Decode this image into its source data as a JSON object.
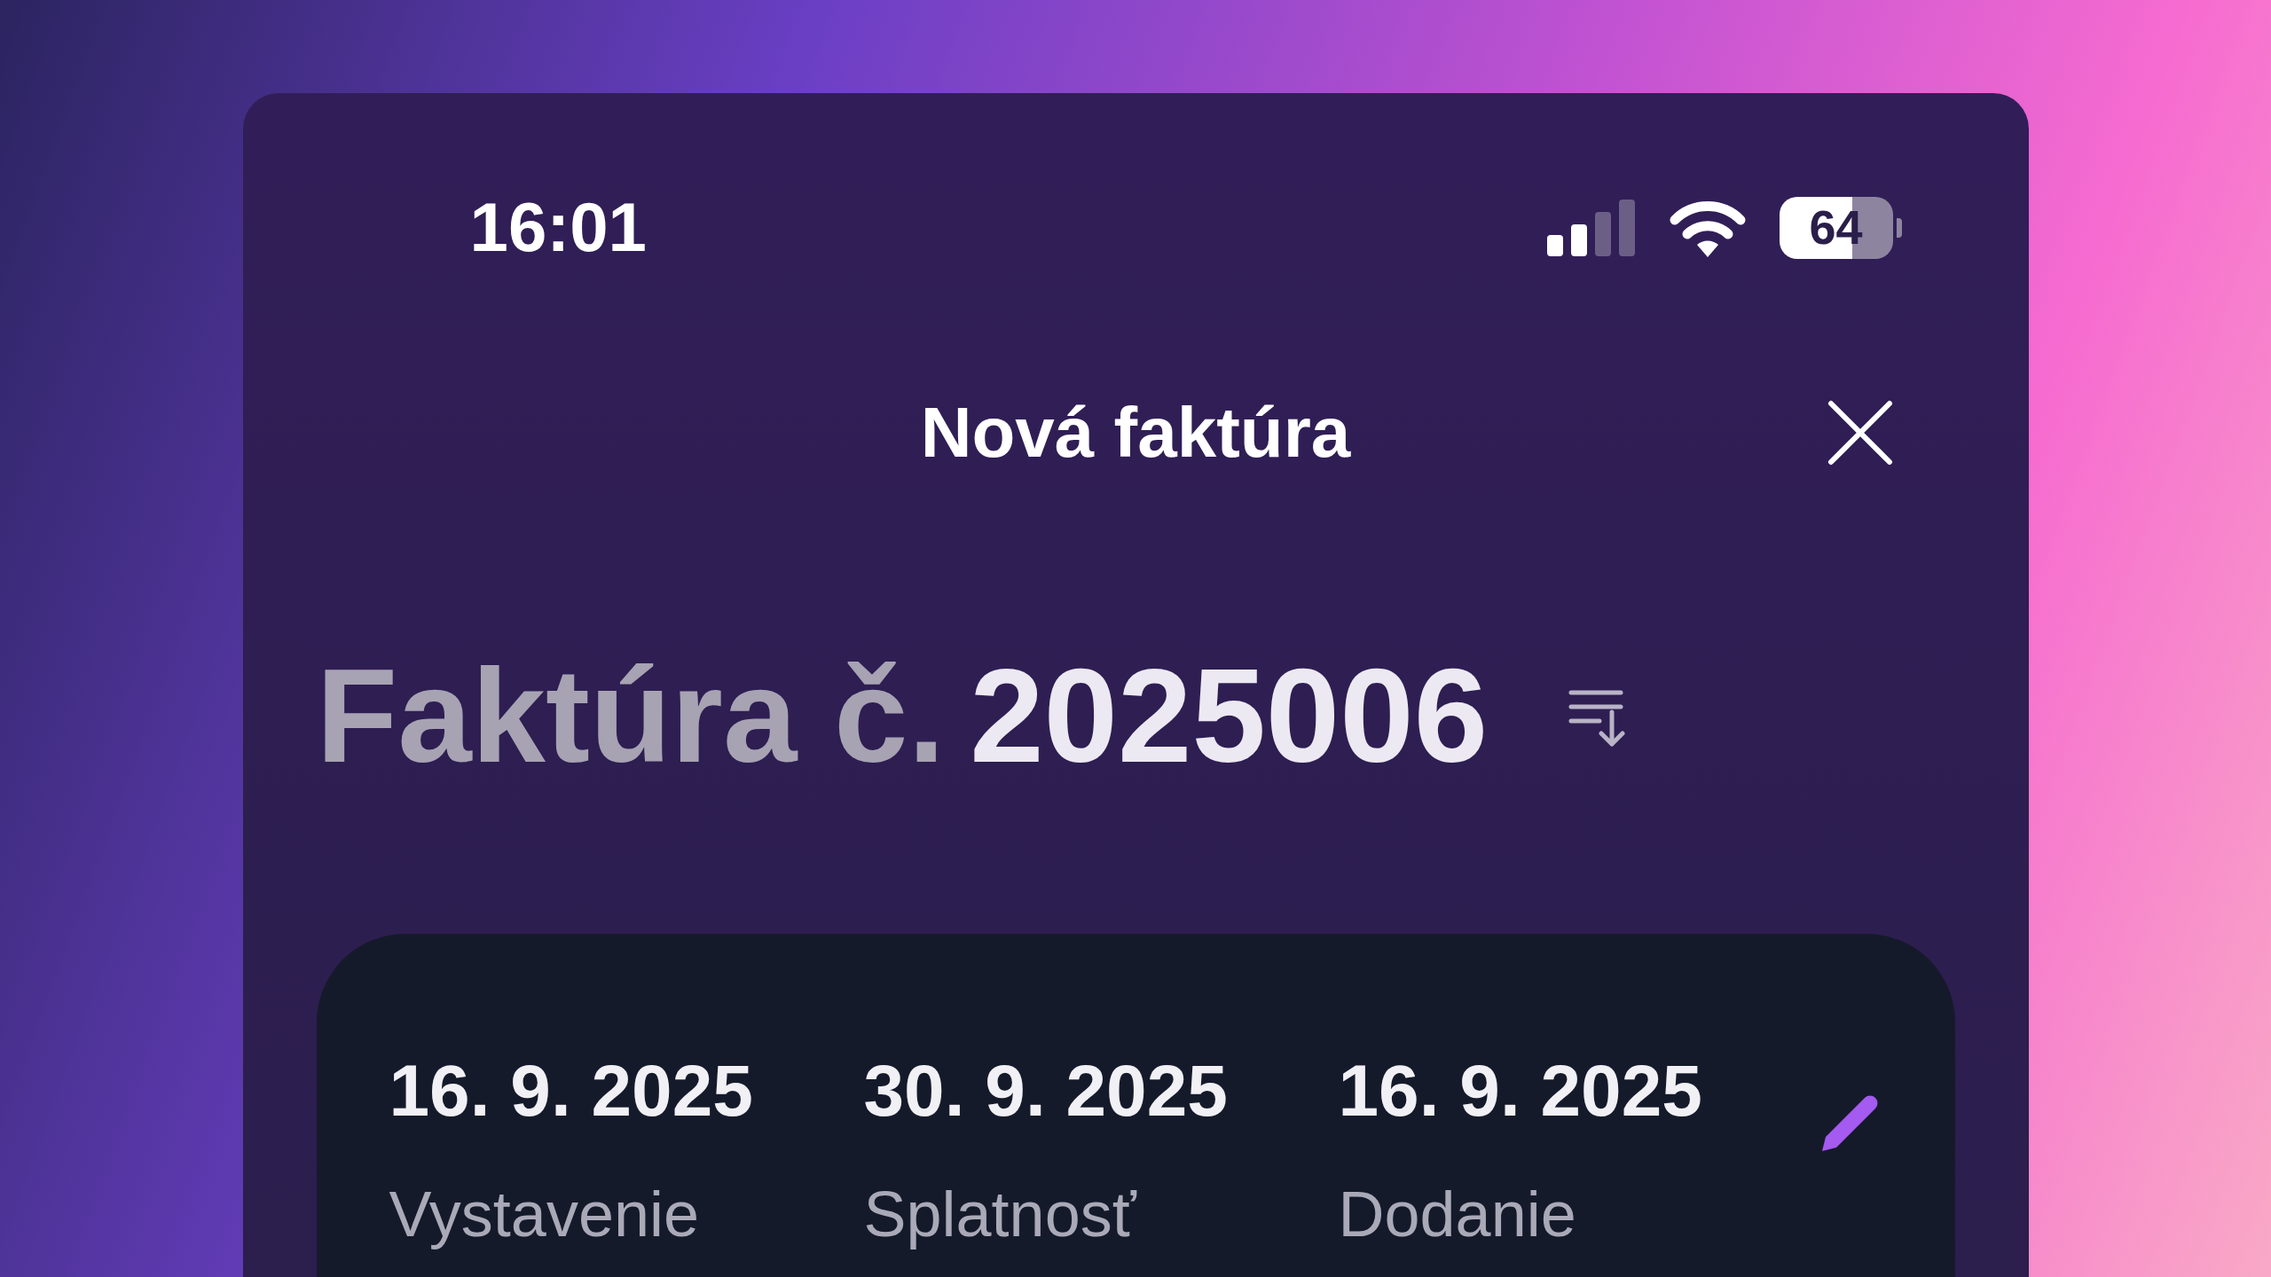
{
  "status_bar": {
    "time": "16:01",
    "battery": "64"
  },
  "header": {
    "title": "Nová faktúra"
  },
  "invoice": {
    "label": "Faktúra č.",
    "number": "2025006"
  },
  "dates": [
    {
      "value": "16. 9. 2025",
      "label": "Vystavenie"
    },
    {
      "value": "30. 9. 2025",
      "label": "Splatnosť"
    },
    {
      "value": "16. 9. 2025",
      "label": "Dodanie"
    }
  ]
}
